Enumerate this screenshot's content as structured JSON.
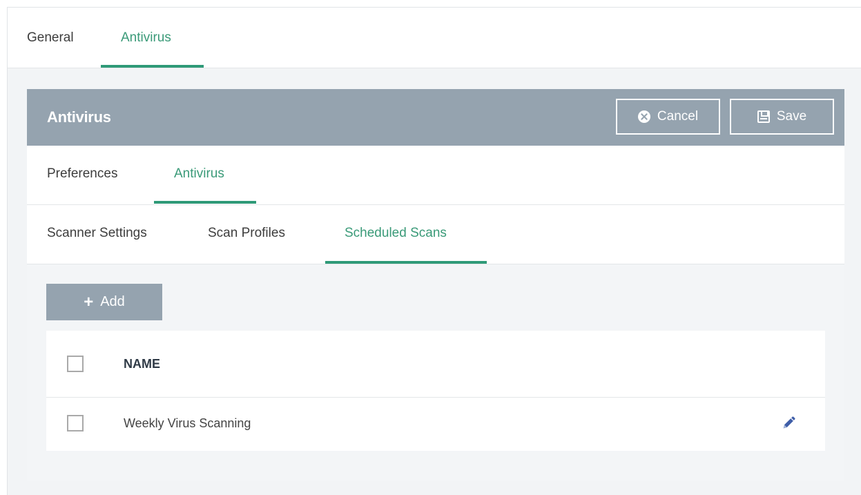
{
  "top_tabs": [
    {
      "label": "General",
      "active": false
    },
    {
      "label": "Antivirus",
      "active": true
    }
  ],
  "panel": {
    "title": "Antivirus",
    "cancel_label": "Cancel",
    "save_label": "Save"
  },
  "sub_tabs": [
    {
      "label": "Preferences",
      "active": false
    },
    {
      "label": "Antivirus",
      "active": true
    }
  ],
  "scan_tabs": [
    {
      "label": "Scanner Settings",
      "active": false
    },
    {
      "label": "Scan Profiles",
      "active": false
    },
    {
      "label": "Scheduled Scans",
      "active": true
    }
  ],
  "toolbar": {
    "add_label": "Add"
  },
  "table": {
    "columns": [
      "NAME"
    ],
    "rows": [
      {
        "name": "Weekly Virus Scanning"
      }
    ]
  },
  "colors": {
    "accent": "#2f9a78",
    "header_bg": "#95a3af"
  }
}
